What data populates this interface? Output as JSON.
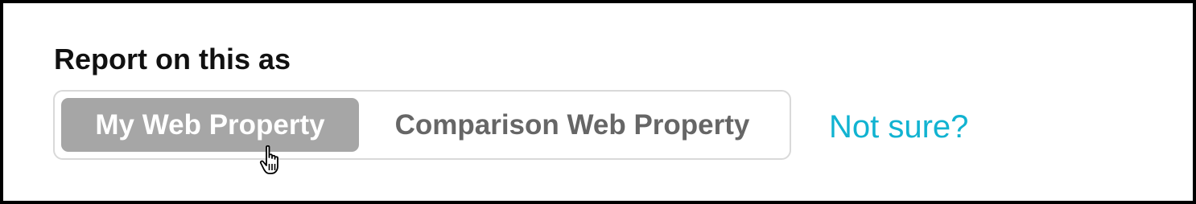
{
  "report": {
    "heading": "Report on this as",
    "options": [
      {
        "label": "My Web Property",
        "selected": true
      },
      {
        "label": "Comparison Web Property",
        "selected": false
      }
    ],
    "help_link": "Not sure?"
  },
  "colors": {
    "selected_bg": "#a6a6a6",
    "selected_text": "#ffffff",
    "unselected_text": "#666666",
    "link": "#11b3d1",
    "border": "#d9d9d9"
  },
  "icons": {
    "cursor": "hand-pointer-cursor-icon"
  }
}
